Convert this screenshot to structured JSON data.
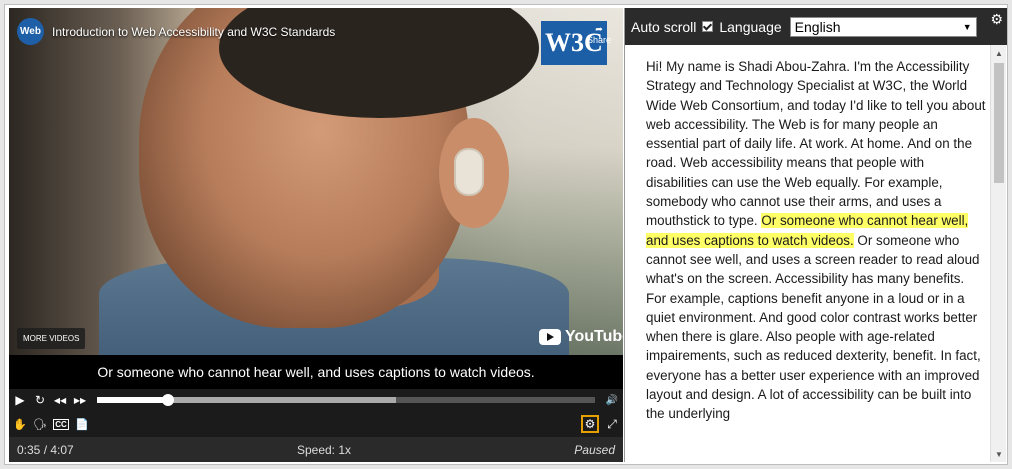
{
  "video": {
    "title": "Introduction to Web Accessibility and W3C Standards",
    "logo_text": "Web",
    "w3c_badge": "W3C",
    "share_label": "Share",
    "more_videos_label": "MORE VIDEOS",
    "youtube_label": "YouTube",
    "caption": "Or someone who cannot hear well, and uses captions to watch videos."
  },
  "controls": {
    "progress_fraction": 0.142,
    "buffered_fraction": 0.6,
    "elapsed": "0:35 / 4:07",
    "speed": "Speed: 1x",
    "state": "Paused"
  },
  "icons": {
    "play": "▶",
    "restart": "↻",
    "rewind": "◀◀",
    "forward": "▶▶",
    "volume": "🔊",
    "sign_language": "✋",
    "audio_description": "🗣",
    "captions": "CC",
    "transcript": "📄",
    "settings": "⚙",
    "fullscreen": "⤢",
    "panel_gear": "⚙"
  },
  "panel": {
    "auto_scroll_label": "Auto scroll",
    "language_label": "Language",
    "language_value": "English"
  },
  "transcript": {
    "before": "Hi! My name is Shadi Abou-Zahra. I'm the Accessibility Strategy and Technology Specialist at W3C, the World Wide Web Consortium, and today I'd like to tell you about web accessibility. The Web is for many people an essential part of daily life. At work. At home. And on the road. Web accessibility means that people with disabilities can use the Web equally. For example, somebody who cannot use their arms, and uses a mouthstick to type. ",
    "highlight": "Or someone who cannot hear well, and uses captions to watch videos.",
    "after": " Or someone who cannot see well, and uses a screen reader to read aloud what's on the screen. Accessibility has many benefits. For example, captions benefit anyone in a loud or in a quiet environment. And good color contrast works better when there is glare. Also people with age-related impairements, such as reduced dexterity, benefit. In fact, everyone has a better user experience with an improved layout and design. A lot of accessibility can be built into the underlying"
  },
  "colors": {
    "highlight": "#ffff66",
    "settings_border": "#e5a000",
    "w3c_blue": "#1c5fa7"
  }
}
